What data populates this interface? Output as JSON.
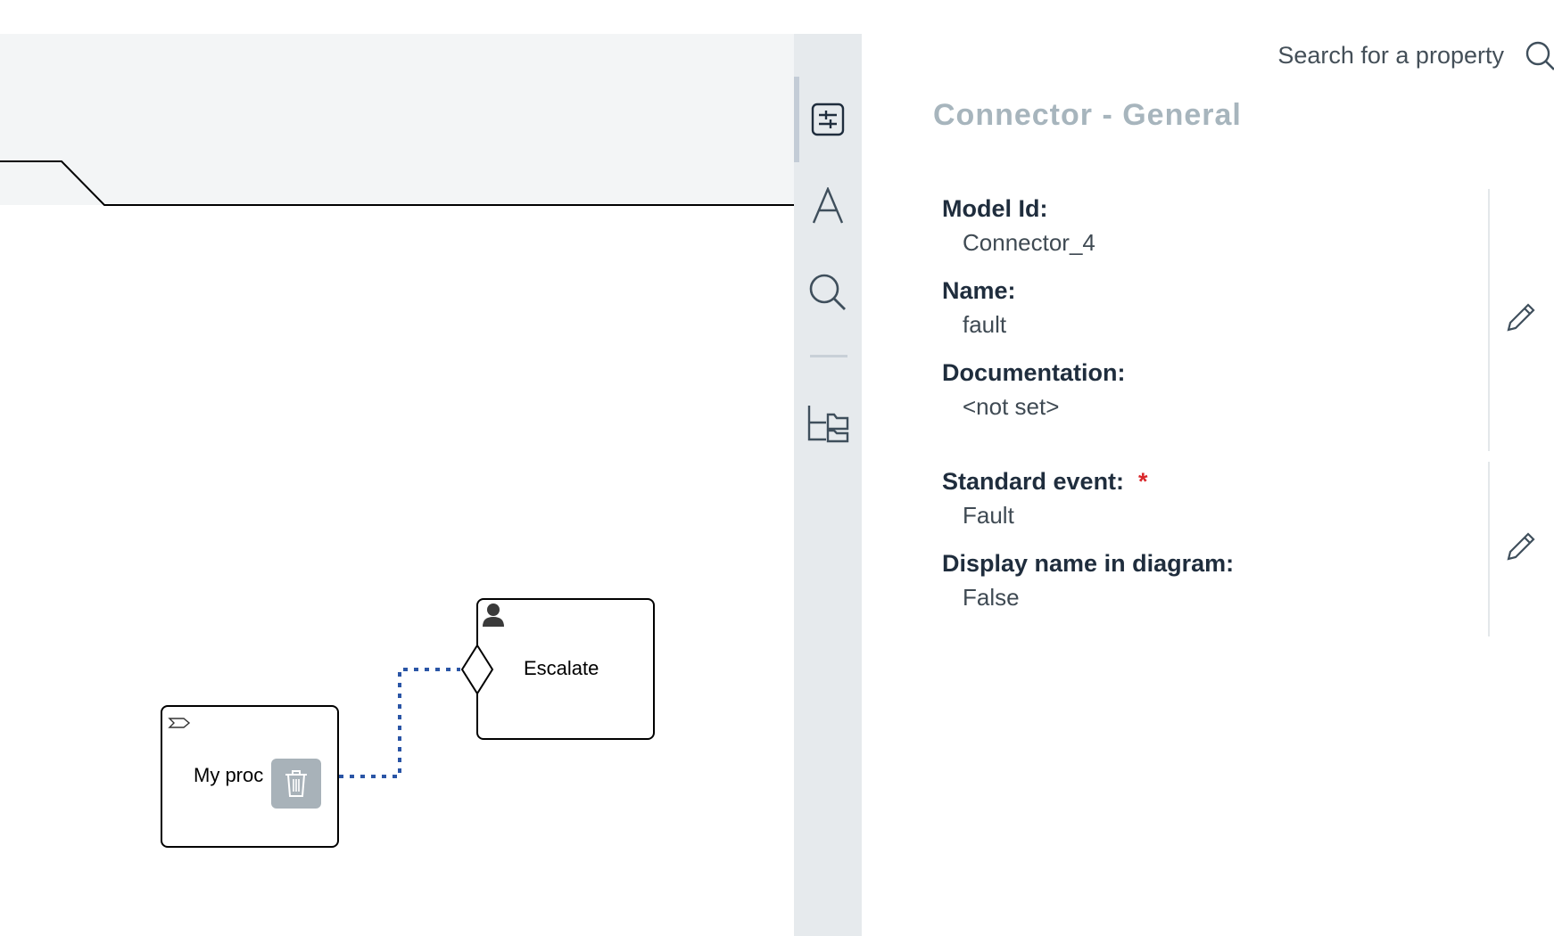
{
  "canvas": {
    "tasks": [
      {
        "id": "task-my-process",
        "label": "My proc",
        "icon": "tag-icon"
      },
      {
        "id": "task-escalate",
        "label": "Escalate",
        "icon": "user-icon"
      }
    ],
    "trash_icon": "trash-icon"
  },
  "toolbar": {
    "tools": [
      {
        "name": "properties-tool",
        "icon": "sliders-icon",
        "active": true
      },
      {
        "name": "text-tool",
        "icon": "font-icon",
        "active": false
      },
      {
        "name": "search-tool",
        "icon": "magnifier-icon",
        "active": false
      },
      {
        "name": "outline-tool",
        "icon": "folder-tree-icon",
        "active": false
      }
    ]
  },
  "panel": {
    "search_placeholder": "Search for a property",
    "title": "Connector - General",
    "groups": [
      {
        "properties": [
          {
            "label": "Model Id:",
            "value": "Connector_4"
          },
          {
            "label": "Name:",
            "value": "fault"
          },
          {
            "label": "Documentation:",
            "value": "<not set>"
          }
        ]
      },
      {
        "properties": [
          {
            "label": "Standard event:",
            "value": "Fault",
            "required_mark": "*"
          },
          {
            "label": "Display name in diagram:",
            "value": "False"
          }
        ]
      }
    ]
  },
  "colors": {
    "connector": "#2a55a6",
    "required": "#d9262a",
    "title": "#a7b5bd",
    "toolbar_bg": "#e6eaed"
  }
}
